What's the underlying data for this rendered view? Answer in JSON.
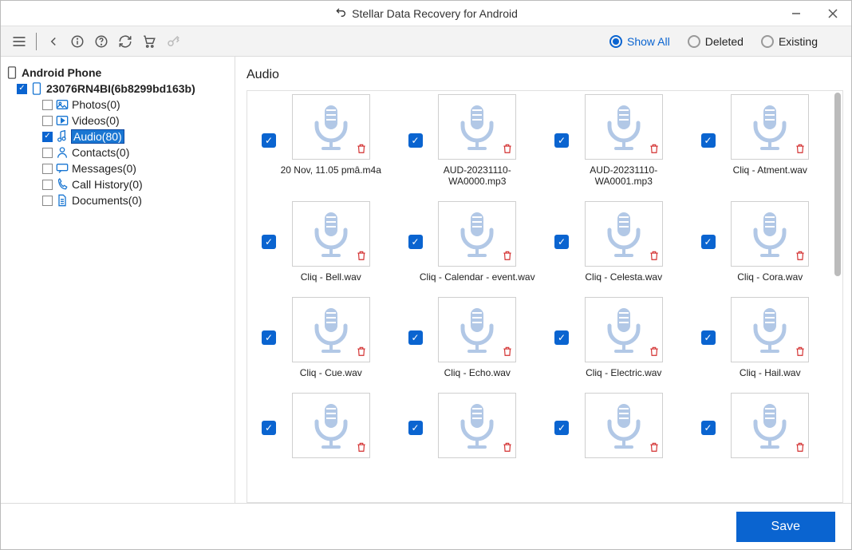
{
  "title": "Stellar Data Recovery for Android",
  "filter": {
    "options": [
      "Show All",
      "Deleted",
      "Existing"
    ],
    "selected": 0
  },
  "tree": {
    "root": "Android Phone",
    "device": "23076RN4BI(6b8299bd163b)",
    "items": [
      {
        "label": "Photos(0)",
        "icon": "image",
        "checked": false
      },
      {
        "label": "Videos(0)",
        "icon": "video",
        "checked": false
      },
      {
        "label": "Audio(80)",
        "icon": "music",
        "checked": true,
        "selected": true
      },
      {
        "label": "Contacts(0)",
        "icon": "contact",
        "checked": false
      },
      {
        "label": "Messages(0)",
        "icon": "message",
        "checked": false
      },
      {
        "label": "Call History(0)",
        "icon": "call",
        "checked": false
      },
      {
        "label": "Documents(0)",
        "icon": "doc",
        "checked": false
      }
    ]
  },
  "content": {
    "title": "Audio",
    "files": [
      {
        "name": "20 Nov, 11.05 pmâ.m4a"
      },
      {
        "name": "AUD-20231110-WA0000.mp3"
      },
      {
        "name": "AUD-20231110-WA0001.mp3"
      },
      {
        "name": "Cliq - Atment.wav"
      },
      {
        "name": "Cliq - Bell.wav"
      },
      {
        "name": "Cliq - Calendar - event.wav"
      },
      {
        "name": "Cliq - Celesta.wav"
      },
      {
        "name": "Cliq - Cora.wav"
      },
      {
        "name": "Cliq - Cue.wav"
      },
      {
        "name": "Cliq - Echo.wav"
      },
      {
        "name": "Cliq - Electric.wav"
      },
      {
        "name": "Cliq - Hail.wav"
      },
      {
        "name": ""
      },
      {
        "name": ""
      },
      {
        "name": ""
      },
      {
        "name": ""
      }
    ]
  },
  "footer": {
    "save": "Save"
  }
}
